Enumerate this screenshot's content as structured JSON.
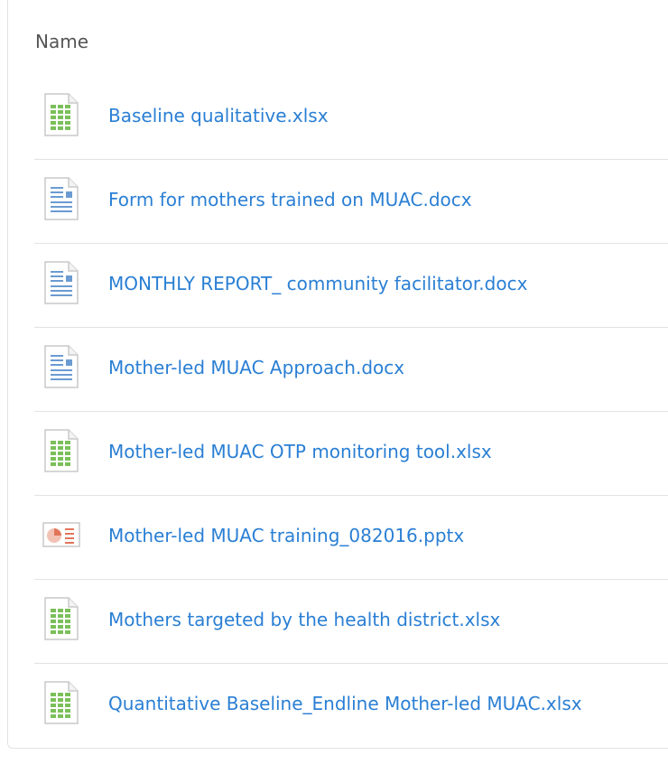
{
  "table": {
    "header_name": "Name"
  },
  "files": [
    {
      "name": "Baseline qualitative.xlsx",
      "icon": "xlsx-file-icon"
    },
    {
      "name": "Form for mothers trained on MUAC.docx",
      "icon": "docx-file-icon"
    },
    {
      "name": "MONTHLY REPORT_ community facilitator.docx",
      "icon": "docx-file-icon"
    },
    {
      "name": "Mother-led MUAC Approach.docx",
      "icon": "docx-file-icon"
    },
    {
      "name": "Mother-led MUAC OTP monitoring tool.xlsx",
      "icon": "xlsx-file-icon"
    },
    {
      "name": "Mother-led MUAC training_082016.pptx",
      "icon": "pptx-file-icon"
    },
    {
      "name": "Mothers targeted by the health district.xlsx",
      "icon": "xlsx-file-icon"
    },
    {
      "name": "Quantitative Baseline_Endline Mother-led MUAC.xlsx",
      "icon": "xlsx-file-icon"
    }
  ],
  "colors": {
    "link": "#2a7fd4",
    "xlsx_green": "#7bbf5a",
    "docx_blue": "#6b9bd2",
    "pptx_orange": "#e2765a"
  }
}
